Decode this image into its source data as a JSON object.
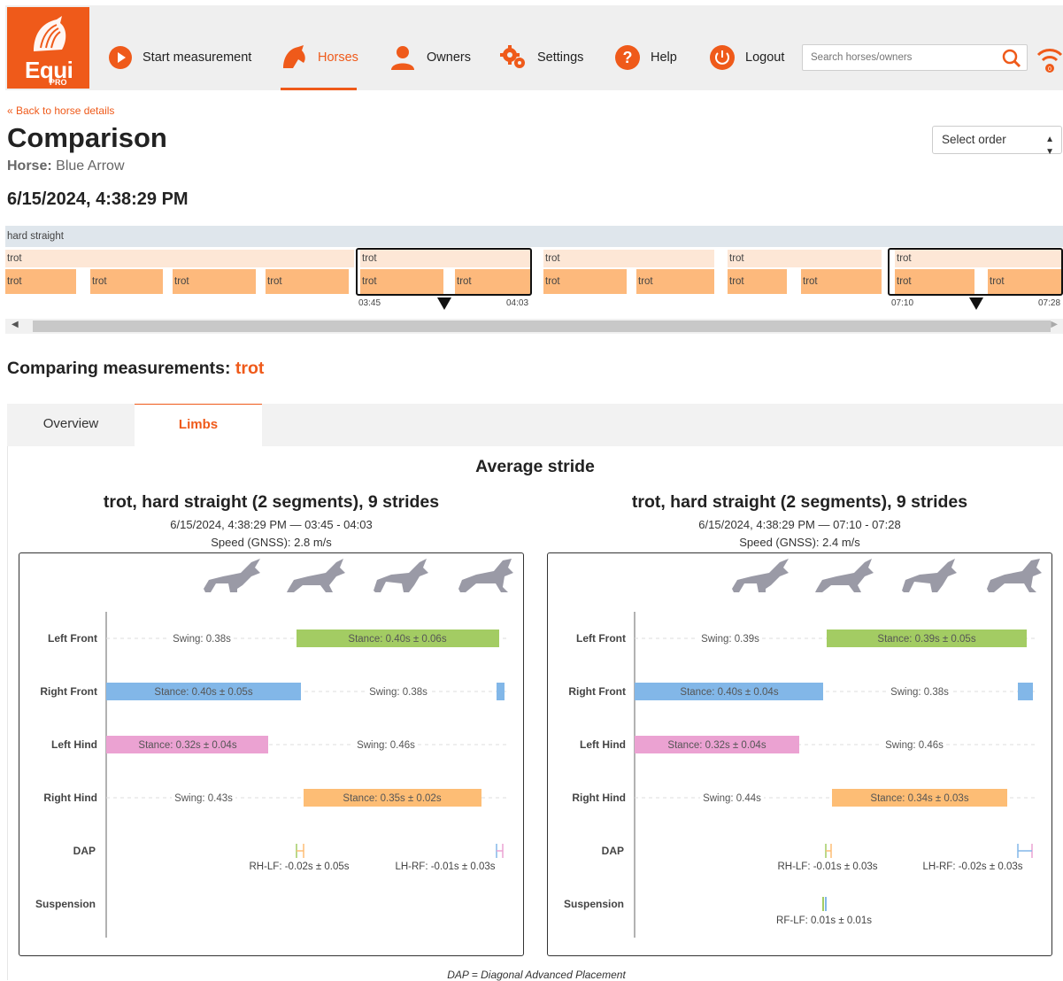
{
  "nav": {
    "logo_text": "Equi",
    "logo_sub": "PRO",
    "items": [
      {
        "label": "Start measurement",
        "icon": "play-icon"
      },
      {
        "label": "Horses",
        "icon": "horse-head-icon",
        "active": true
      },
      {
        "label": "Owners",
        "icon": "person-icon"
      },
      {
        "label": "Settings",
        "icon": "gears-icon"
      },
      {
        "label": "Help",
        "icon": "question-icon"
      },
      {
        "label": "Logout",
        "icon": "power-icon"
      }
    ],
    "search_placeholder": "Search horses/owners",
    "wifi_badge": "0"
  },
  "colors": {
    "accent": "#ef5a1a",
    "left_front": "#a3cc63",
    "right_front": "#82b7e8",
    "left_hind": "#eba2d2",
    "right_hind": "#fdbd75"
  },
  "header": {
    "back_link": "« Back to horse details",
    "title": "Comparison",
    "horse_label": "Horse:",
    "horse_name": "Blue Arrow",
    "select_order": "Select order",
    "datetime": "6/15/2024, 4:38:29 PM"
  },
  "timeline": {
    "top_label": "hard straight",
    "mid_label": "trot",
    "segment_label": "trot",
    "sel1_start": "03:45",
    "sel1_end": "04:03",
    "sel2_start": "07:10",
    "sel2_end": "07:28"
  },
  "comparing": {
    "prefix": "Comparing measurements:",
    "gait": "trot"
  },
  "tabs": {
    "overview": "Overview",
    "limbs": "Limbs"
  },
  "average_title": "Average stride",
  "rows": [
    "Left Front",
    "Right Front",
    "Left Hind",
    "Right Hind",
    "DAP",
    "Suspension"
  ],
  "charts": [
    {
      "title": "trot, hard straight (2 segments), 9 strides",
      "subtitle": "6/15/2024, 4:38:29 PM — 03:45 - 04:03",
      "speed": "Speed (GNSS): 2.8 m/s",
      "lf": {
        "swing": "Swing: 0.38s",
        "stance": "Stance: 0.40s ± 0.06s"
      },
      "rf": {
        "swing": "Swing: 0.38s",
        "stance": "Stance: 0.40s ± 0.05s"
      },
      "lh": {
        "swing": "Swing: 0.46s",
        "stance": "Stance: 0.32s ± 0.04s"
      },
      "rh": {
        "swing": "Swing: 0.43s",
        "stance": "Stance: 0.35s ± 0.02s"
      },
      "dap1": "RH-LF: -0.02s ± 0.05s",
      "dap2": "LH-RF: -0.01s ± 0.03s",
      "suspension": ""
    },
    {
      "title": "trot, hard straight (2 segments), 9 strides",
      "subtitle": "6/15/2024, 4:38:29 PM — 07:10 - 07:28",
      "speed": "Speed (GNSS): 2.4 m/s",
      "lf": {
        "swing": "Swing: 0.39s",
        "stance": "Stance: 0.39s ± 0.05s"
      },
      "rf": {
        "swing": "Swing: 0.38s",
        "stance": "Stance: 0.40s ± 0.04s"
      },
      "lh": {
        "swing": "Swing: 0.46s",
        "stance": "Stance: 0.32s ± 0.04s"
      },
      "rh": {
        "swing": "Swing: 0.44s",
        "stance": "Stance: 0.34s ± 0.03s"
      },
      "dap1": "RH-LF: -0.01s ± 0.03s",
      "dap2": "LH-RF: -0.02s ± 0.03s",
      "suspension": "RF-LF: 0.01s ± 0.01s"
    }
  ],
  "footnote": "DAP = Diagonal Advanced Placement"
}
